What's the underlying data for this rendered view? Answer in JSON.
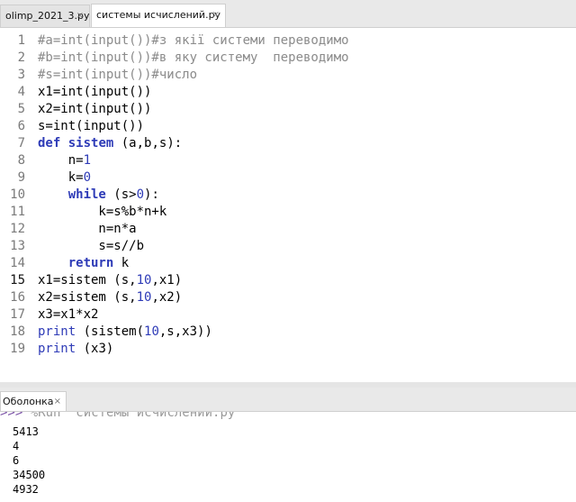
{
  "editor": {
    "tabs": [
      {
        "label": "olimp_2021_3.py",
        "close": "×"
      },
      {
        "label": "системы исчислений.py",
        "close": "×"
      }
    ],
    "lines": [
      {
        "n": "1",
        "segs": [
          {
            "t": "#a=int(input())#з якії системи переводимо",
            "s": "c"
          }
        ]
      },
      {
        "n": "2",
        "segs": [
          {
            "t": "#b=int(input())#в яку систему  переводимо",
            "s": "c"
          }
        ]
      },
      {
        "n": "3",
        "segs": [
          {
            "t": "#s=int(input())#число",
            "s": "c"
          }
        ]
      },
      {
        "n": "4",
        "segs": [
          {
            "t": "x1=int(input())",
            "s": ""
          }
        ]
      },
      {
        "n": "5",
        "segs": [
          {
            "t": "x2=int(input())",
            "s": ""
          }
        ]
      },
      {
        "n": "6",
        "segs": [
          {
            "t": "s=int(input())",
            "s": ""
          }
        ]
      },
      {
        "n": "7",
        "segs": [
          {
            "t": "def",
            "s": "k"
          },
          {
            "t": " ",
            "s": ""
          },
          {
            "t": "sistem",
            "s": "k"
          },
          {
            "t": " (a,b,s):",
            "s": ""
          }
        ]
      },
      {
        "n": "8",
        "segs": [
          {
            "t": "    n=",
            "s": ""
          },
          {
            "t": "1",
            "s": "n"
          }
        ]
      },
      {
        "n": "9",
        "segs": [
          {
            "t": "    k=",
            "s": ""
          },
          {
            "t": "0",
            "s": "n"
          }
        ]
      },
      {
        "n": "10",
        "segs": [
          {
            "t": "    ",
            "s": ""
          },
          {
            "t": "while",
            "s": "k"
          },
          {
            "t": " (s>",
            "s": ""
          },
          {
            "t": "0",
            "s": "n"
          },
          {
            "t": "):",
            "s": ""
          }
        ]
      },
      {
        "n": "11",
        "segs": [
          {
            "t": "        k=s%b*n+k",
            "s": ""
          }
        ]
      },
      {
        "n": "12",
        "segs": [
          {
            "t": "        n=n*a",
            "s": ""
          }
        ]
      },
      {
        "n": "13",
        "segs": [
          {
            "t": "        s=s//b",
            "s": ""
          }
        ]
      },
      {
        "n": "14",
        "segs": [
          {
            "t": "    ",
            "s": ""
          },
          {
            "t": "return",
            "s": "k"
          },
          {
            "t": " k",
            "s": ""
          }
        ]
      },
      {
        "n": "15",
        "segs": [
          {
            "t": "x1=sistem (s,",
            "s": ""
          },
          {
            "t": "10",
            "s": "n"
          },
          {
            "t": ",x1)",
            "s": ""
          }
        ]
      },
      {
        "n": "16",
        "segs": [
          {
            "t": "x2=sistem (s,",
            "s": ""
          },
          {
            "t": "10",
            "s": "n"
          },
          {
            "t": ",x2)",
            "s": ""
          }
        ]
      },
      {
        "n": "17",
        "segs": [
          {
            "t": "x3=x1*x2",
            "s": ""
          }
        ]
      },
      {
        "n": "18",
        "segs": [
          {
            "t": "print",
            "s": "n"
          },
          {
            "t": " (sistem(",
            "s": ""
          },
          {
            "t": "10",
            "s": "n"
          },
          {
            "t": ",s,x3))",
            "s": ""
          }
        ]
      },
      {
        "n": "19",
        "segs": [
          {
            "t": "print",
            "s": "n"
          },
          {
            "t": " (x3)",
            "s": ""
          }
        ]
      }
    ]
  },
  "shell": {
    "tab": {
      "label": "Оболонка",
      "close": "×"
    },
    "prompt_arrows": ">>>",
    "prompt_text": " %Run  системы исчислений.py",
    "output": [
      "5413",
      "4",
      "6",
      "34500",
      "4932"
    ]
  }
}
